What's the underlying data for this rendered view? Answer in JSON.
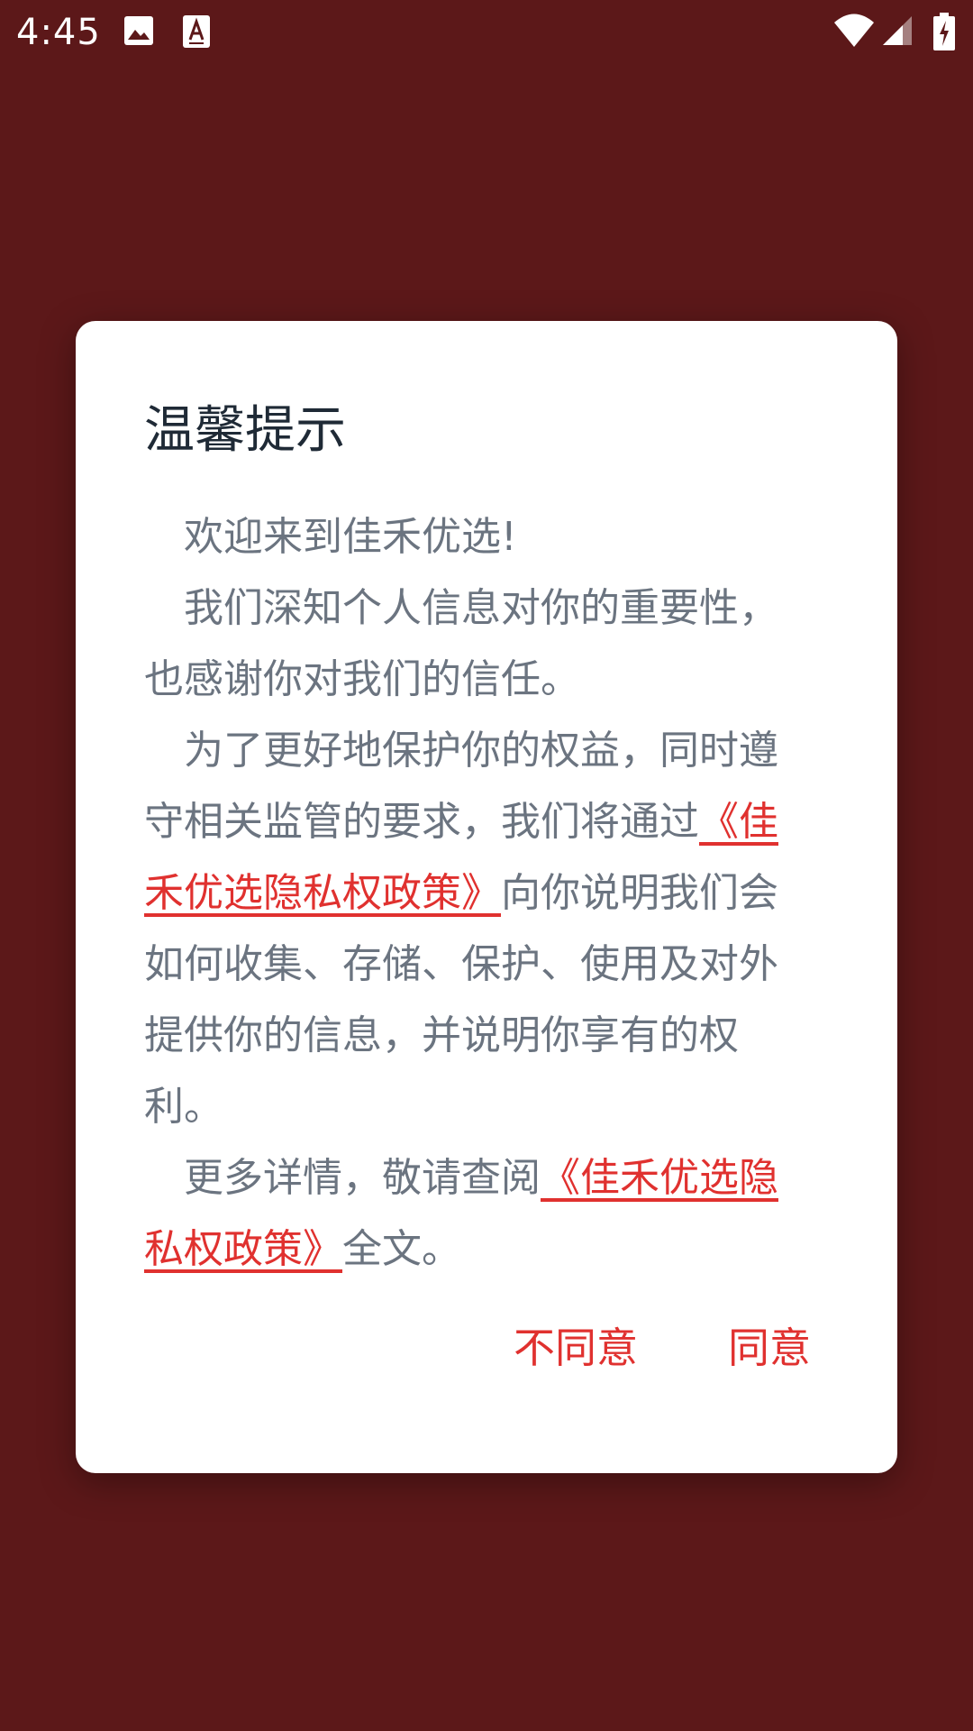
{
  "status_bar": {
    "time": "4:45",
    "icons": [
      "gallery-icon",
      "a-notification-icon",
      "wifi-icon",
      "signal-icon",
      "battery-charging-icon"
    ]
  },
  "dialog": {
    "title": "温馨提示",
    "paragraphs": {
      "p1": {
        "text": "欢迎来到佳禾优选!"
      },
      "p2": {
        "text": "我们深知个人信息对你的重要性，也感谢你对我们的信任。"
      },
      "p3": {
        "before": "为了更好地保护你的权益，同时遵守相关监管的要求，我们将通过",
        "link": "《佳禾优选隐私权政策》",
        "after": "向你说明我们会如何收集、存储、保护、使用及对外提供你的信息，并说明你享有的权利。"
      },
      "p4": {
        "before": "更多详情，敬请查阅",
        "link": "《佳禾优选隐私权政策》",
        "after": "全文。"
      }
    },
    "buttons": {
      "disagree": "不同意",
      "agree": "同意"
    }
  },
  "colors": {
    "background": "#5c1819",
    "accent": "#e0312f",
    "body_text": "#6b7480",
    "title_text": "#1f2a36"
  }
}
